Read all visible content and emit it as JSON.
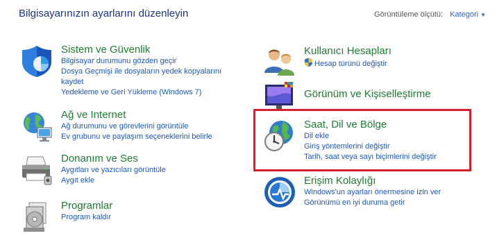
{
  "header": {
    "title": "Bilgisayarınızın ayarlarını düzenleyin",
    "view_by_label": "Görüntüleme ölçütü:",
    "view_by_value": "Kategori"
  },
  "left_column": [
    {
      "title": "Sistem ve Güvenlik",
      "icon": "system-security-icon",
      "links": [
        "Bilgisayar durumunu gözden geçir",
        "Dosya Geçmişi ile dosyaların yedek kopyalarını",
        "kaydet",
        "Yedekleme ve Geri Yükleme (Windows 7)"
      ]
    },
    {
      "title": "Ağ ve Internet",
      "icon": "network-globe-icon",
      "links": [
        "Ağ durumunu ve görevlerini görüntüle",
        "Ev grubunu ve paylaşım seçeneklerini belirle"
      ]
    },
    {
      "title": "Donanım ve Ses",
      "icon": "printer-hardware-icon",
      "links": [
        "Aygıtları ve yazıcıları görüntüle",
        "Aygıt ekle"
      ]
    },
    {
      "title": "Programlar",
      "icon": "programs-disc-icon",
      "links": [
        "Program kaldır"
      ]
    }
  ],
  "right_column": [
    {
      "title": "Kullanıcı Hesapları",
      "icon": "users-icon",
      "links": [
        "Hesap türünü değiştir"
      ]
    },
    {
      "title": "Görünüm ve Kişiselleştirme",
      "icon": "appearance-monitor-icon",
      "links": []
    },
    {
      "title": "Saat, Dil ve Bölge",
      "icon": "clock-globe-icon",
      "links": [
        "Dil ekle",
        "Giriş yöntemlerini değiştir",
        "Tarih, saat veya sayı biçimlerini değiştir"
      ]
    },
    {
      "title": "Erişim Kolaylığı",
      "icon": "ease-of-access-icon",
      "links": [
        "Windows'un ayarları önermesine izin ver",
        "Görünümü en iyi duruma getir"
      ]
    }
  ],
  "colors": {
    "title_green": "#1f7c31",
    "link_blue": "#1a58c0",
    "highlight_red": "#d4202c"
  }
}
